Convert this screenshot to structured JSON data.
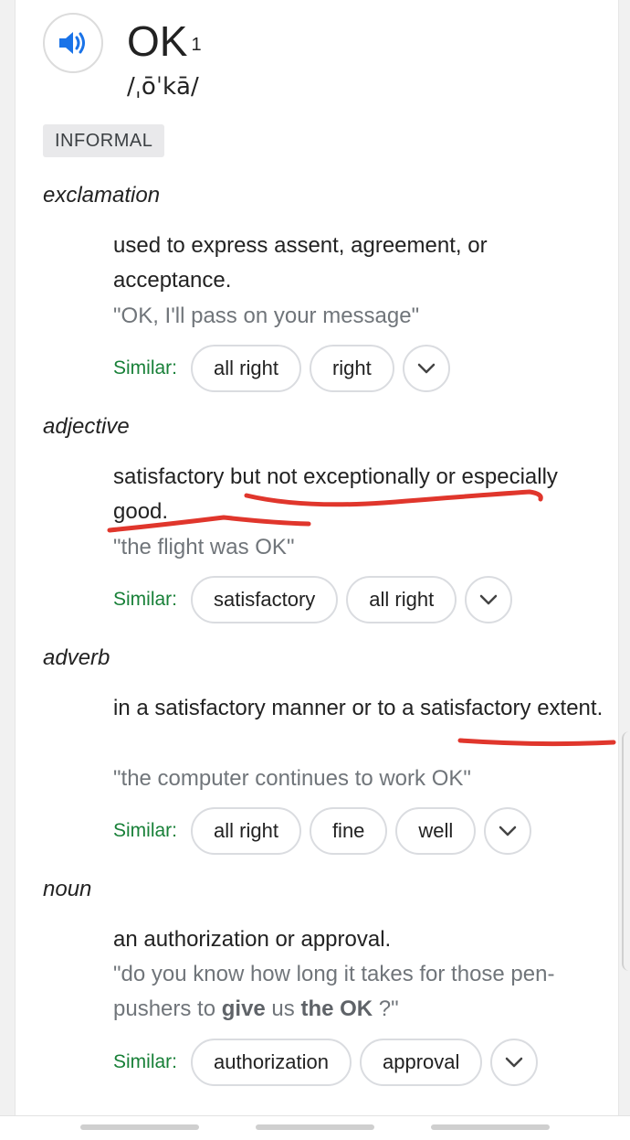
{
  "entry": {
    "word": "OK",
    "superscript": "1",
    "phonetic": "/ˌōˈkā/",
    "register_label": "INFORMAL",
    "speaker_icon": "speaker-icon"
  },
  "senses": [
    {
      "part_of_speech": "exclamation",
      "definition": "used to express assent, agreement, or acceptance.",
      "example": "\"OK, I'll pass on your message\"",
      "similar_label": "Similar:",
      "similar": [
        "all right",
        "right"
      ]
    },
    {
      "part_of_speech": "adjective",
      "definition": "satisfactory but not exceptionally or especially good.",
      "example": "\"the flight was OK\"",
      "similar_label": "Similar:",
      "similar": [
        "satisfactory",
        "all right"
      ]
    },
    {
      "part_of_speech": "adverb",
      "definition": "in a satisfactory manner or to a satisfactory extent.",
      "example": "\"the computer continues to work OK\"",
      "similar_label": "Similar:",
      "similar": [
        "all right",
        "fine",
        "well"
      ]
    },
    {
      "part_of_speech": "noun",
      "definition": "an authorization or approval.",
      "example_parts": [
        "\"do you know how long it takes for those pen-pushers to ",
        "give",
        " us ",
        "the OK",
        " ?\""
      ],
      "similar_label": "Similar:",
      "similar": [
        "authorization",
        "approval"
      ]
    }
  ],
  "colors": {
    "speaker_blue": "#1a73e8",
    "similar_green": "#188038",
    "annotation_red": "#e0362c"
  },
  "icons": {
    "expand": "chevron-down-icon"
  }
}
